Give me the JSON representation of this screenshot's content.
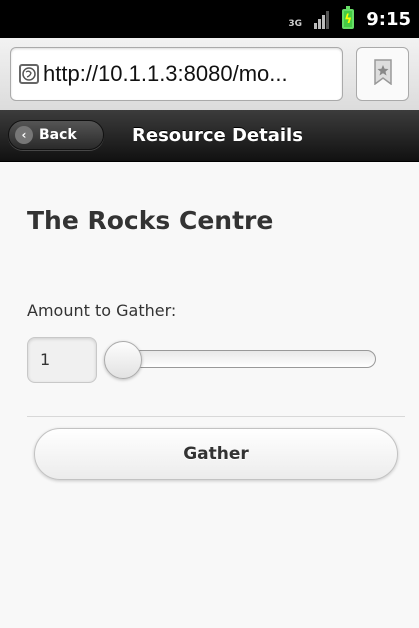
{
  "status_bar": {
    "network_label": "3G",
    "time": "9:15",
    "icons": [
      "network-3g-icon",
      "signal-strength-icon",
      "battery-charging-icon"
    ]
  },
  "browser": {
    "url": "http://10.1.1.3:8080/mo...",
    "icons": [
      "globe-icon",
      "bookmark-icon"
    ]
  },
  "header": {
    "back_label": "Back",
    "title": "Resource Details"
  },
  "main": {
    "heading": "The Rocks Centre",
    "amount_label": "Amount to Gather:",
    "amount_value": "1",
    "slider_fraction": 0,
    "gather_label": "Gather"
  },
  "colors": {
    "header_bg": "#1f1f1f",
    "content_bg": "#f8f8f8",
    "battery": "#44cc44"
  }
}
